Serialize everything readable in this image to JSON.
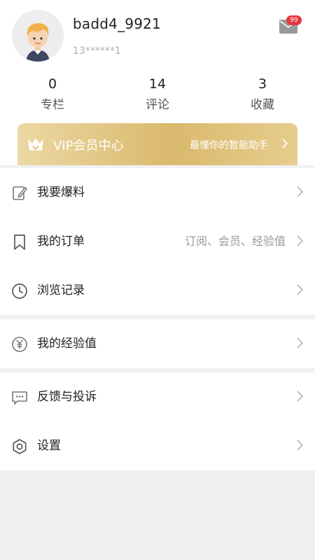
{
  "profile": {
    "username": "badd4_9921",
    "phone": "13******1",
    "avatar_icon": "cartoon-boy-avatar",
    "mail_icon": "envelope-icon",
    "mail_badge": "99"
  },
  "stats": [
    {
      "value": "0",
      "label": "专栏"
    },
    {
      "value": "14",
      "label": "评论"
    },
    {
      "value": "3",
      "label": "收藏"
    }
  ],
  "vip": {
    "icon": "crown-icon",
    "title": "VIP会员中心",
    "subtitle": "最懂你的智能助手"
  },
  "menu": {
    "group1": [
      {
        "label": "我要爆料",
        "icon": "edit-icon",
        "extra": ""
      },
      {
        "label": "我的订单",
        "icon": "bookmark-icon",
        "extra": "订阅、会员、经验值"
      },
      {
        "label": "浏览记录",
        "icon": "clock-icon",
        "extra": ""
      }
    ],
    "group2": [
      {
        "label": "我的经验值",
        "icon": "yen-coin-icon",
        "extra": ""
      }
    ],
    "group3": [
      {
        "label": "反馈与投诉",
        "icon": "chat-icon",
        "extra": ""
      },
      {
        "label": "设置",
        "icon": "gear-icon",
        "extra": ""
      }
    ]
  },
  "colors": {
    "badge": "#e8363f",
    "vip_gold": "#d9b96c",
    "background": "#f0f0f2"
  }
}
